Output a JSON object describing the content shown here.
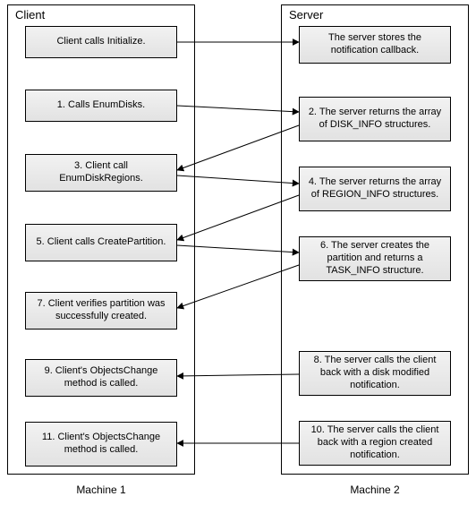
{
  "client": {
    "title": "Client",
    "caption": "Machine 1",
    "boxes": [
      "Client calls Initialize.",
      "1. Calls EnumDisks.",
      "3. Client call EnumDiskRegions.",
      "5. Client calls CreatePartition.",
      "7. Client verifies partition was successfully created.",
      "9. Client's ObjectsChange method is called.",
      "11. Client's ObjectsChange method is called."
    ]
  },
  "server": {
    "title": "Server",
    "caption": "Machine 2",
    "boxes": [
      "The server stores the notification callback.",
      "2. The server returns the array of DISK_INFO structures.",
      "4. The server returns the array of REGION_INFO structures.",
      "6. The server creates the partition and returns a TASK_INFO structure.",
      "8. The server calls the client back with a disk modified notification.",
      "10. The server calls the client back with a region created notification."
    ]
  }
}
